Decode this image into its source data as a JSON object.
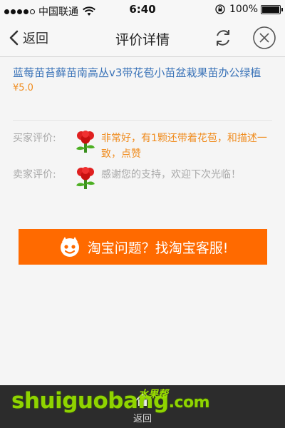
{
  "status_bar": {
    "carrier": "中国联通",
    "time": "6:40",
    "battery": "100%",
    "battery_level": 1.0,
    "signal_bars": 4
  },
  "nav": {
    "back_label": "返回",
    "title": "评价详情",
    "refresh_icon": "refresh-icon",
    "close_icon": "close-icon"
  },
  "product": {
    "name": "蓝莓苗苔藓苗南高丛v3带花苞小苗盆栽果苗办公绿植",
    "price": "¥5.0"
  },
  "reviews": {
    "buyer": {
      "label": "买家评价:",
      "icon": "flower-icon",
      "text": "非常好，有1颗还带着花苞，和描述一致，点赞"
    },
    "seller": {
      "label": "卖家评价:",
      "icon": "flower-icon",
      "text": "感谢您的支持，欢迎下次光临！"
    }
  },
  "service_button": {
    "label": "淘宝问题？找淘宝客服!",
    "icon": "taobao-mascot-icon"
  },
  "bottom_bar": {
    "label": "返回",
    "icon": "home-icon"
  },
  "watermark": {
    "text_main": "shuiguobang",
    "text_suffix": ".com",
    "text_cn": "水果帮"
  },
  "colors": {
    "accent_orange": "#ff6a00",
    "price_orange": "#f08c1e",
    "link_blue": "#3a73b8",
    "muted_gray": "#a8a8a8",
    "bottom_bar": "#2c2c2c"
  }
}
